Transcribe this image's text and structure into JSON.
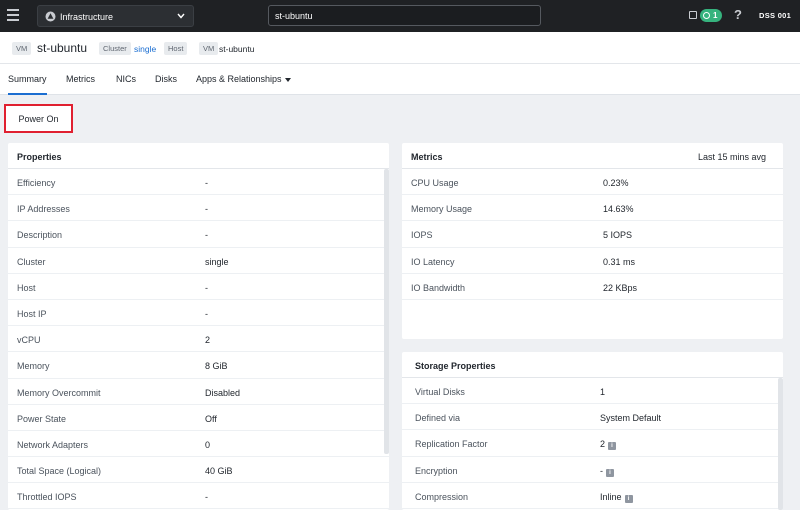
{
  "topbar": {
    "app_name": "Infrastructure",
    "search_value": "st-ubuntu",
    "tasks_count": "1",
    "help_label": "?",
    "user": "DSS 001"
  },
  "entity": {
    "type_tag": "VM",
    "name": "st-ubuntu",
    "cluster_tag": "Cluster",
    "cluster_name": "single",
    "host_tag": "Host",
    "vm_tag": "VM",
    "vm_name": "st-ubuntu"
  },
  "tabs": [
    {
      "label": "Summary"
    },
    {
      "label": "Metrics"
    },
    {
      "label": "NICs"
    },
    {
      "label": "Disks"
    },
    {
      "label": "Apps & Relationships"
    }
  ],
  "actions": {
    "power_on": "Power On"
  },
  "properties": {
    "title": "Properties",
    "rows": [
      {
        "key": "Efficiency",
        "value": "-"
      },
      {
        "key": "IP Addresses",
        "value": "-"
      },
      {
        "key": "Description",
        "value": "-"
      },
      {
        "key": "Cluster",
        "value": "single"
      },
      {
        "key": "Host",
        "value": "-"
      },
      {
        "key": "Host IP",
        "value": "-"
      },
      {
        "key": "vCPU",
        "value": "2"
      },
      {
        "key": "Memory",
        "value": "8 GiB"
      },
      {
        "key": "Memory Overcommit",
        "value": "Disabled"
      },
      {
        "key": "Power State",
        "value": "Off"
      },
      {
        "key": "Network Adapters",
        "value": "0"
      },
      {
        "key": "Total Space (Logical)",
        "value": "40 GiB"
      },
      {
        "key": "Throttled IOPS",
        "value": "-"
      }
    ]
  },
  "metrics": {
    "title": "Metrics",
    "range": "Last 15 mins avg",
    "rows": [
      {
        "key": "CPU Usage",
        "value": "0.23%"
      },
      {
        "key": "Memory Usage",
        "value": "14.63%"
      },
      {
        "key": "IOPS",
        "value": "5 IOPS"
      },
      {
        "key": "IO Latency",
        "value": "0.31 ms"
      },
      {
        "key": "IO Bandwidth",
        "value": "22 KBps"
      }
    ]
  },
  "storage": {
    "title": "Storage Properties",
    "rows": [
      {
        "key": "Virtual Disks",
        "value": "1"
      },
      {
        "key": "Defined via",
        "value": "System Default"
      },
      {
        "key": "Replication Factor",
        "value": "2"
      },
      {
        "key": "Encryption",
        "value": "-"
      },
      {
        "key": "Compression",
        "value": "Inline"
      }
    ]
  },
  "icons": {
    "menu": "hamburger-icon",
    "app": "triangle-logo-icon",
    "tasks": "tasks-icon",
    "info": "info-icon"
  },
  "colors": {
    "topbar": "#1f2124",
    "accent": "#1b6ed1",
    "highlight_border": "#e02030",
    "badge": "#36b37e"
  }
}
